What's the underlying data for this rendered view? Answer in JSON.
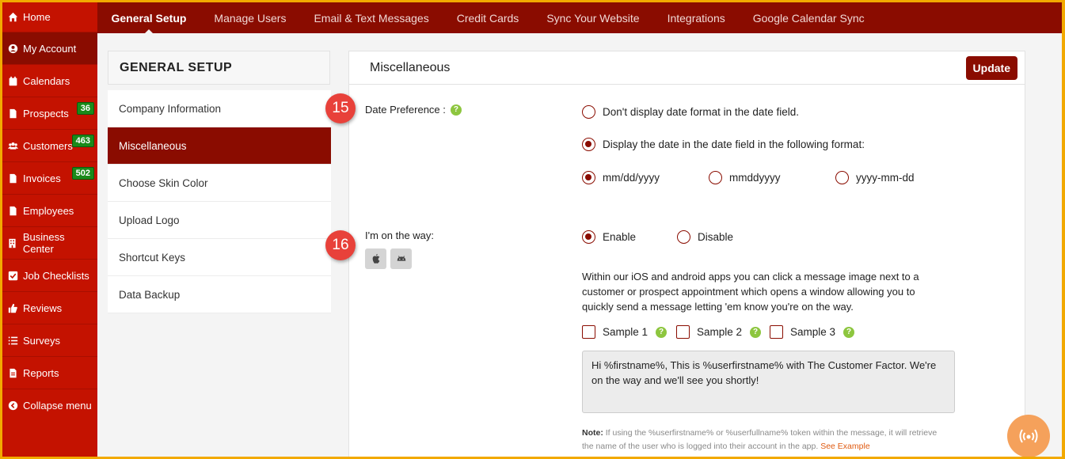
{
  "sidebar": {
    "items": [
      {
        "label": "Home",
        "icon": "home-icon"
      },
      {
        "label": "My Account",
        "icon": "user-circle-icon"
      },
      {
        "label": "Calendars",
        "icon": "calendar-icon"
      },
      {
        "label": "Prospects",
        "icon": "document-icon",
        "badge": "36"
      },
      {
        "label": "Customers",
        "icon": "users-icon",
        "badge": "463"
      },
      {
        "label": "Invoices",
        "icon": "document-icon",
        "badge": "502"
      },
      {
        "label": "Employees",
        "icon": "document-icon"
      },
      {
        "label": "Business Center",
        "icon": "building-icon"
      },
      {
        "label": "Job Checklists",
        "icon": "checkbox-icon"
      },
      {
        "label": "Reviews",
        "icon": "thumbs-up-icon"
      },
      {
        "label": "Surveys",
        "icon": "list-icon"
      },
      {
        "label": "Reports",
        "icon": "report-icon"
      },
      {
        "label": "Collapse menu",
        "icon": "chevron-left-circle-icon"
      }
    ]
  },
  "topnav": {
    "tabs": [
      "General Setup",
      "Manage Users",
      "Email & Text Messages",
      "Credit Cards",
      "Sync Your Website",
      "Integrations",
      "Google Calendar Sync"
    ]
  },
  "setup": {
    "heading": "GENERAL SETUP",
    "items": [
      "Company Information",
      "Miscellaneous",
      "Choose Skin Color",
      "Upload Logo",
      "Shortcut Keys",
      "Data Backup"
    ]
  },
  "main": {
    "title": "Miscellaneous",
    "update_label": "Update",
    "date_pref": {
      "step": "15",
      "label": "Date Preference :",
      "opt_none": "Don't display date format in the date field.",
      "opt_format": "Display the date in the date field in the following format:",
      "formats": [
        "mm/dd/yyyy",
        "mmddyyyy",
        "yyyy-mm-dd"
      ]
    },
    "on_way": {
      "step": "16",
      "label": "I'm on the way:",
      "enable": "Enable",
      "disable": "Disable",
      "description": "Within our iOS and android apps you can click a message image next to a customer or prospect appointment which opens a window allowing you to quickly send a message letting 'em know you're on the way.",
      "samples": [
        "Sample 1",
        "Sample 2",
        "Sample 3"
      ],
      "message": "Hi %firstname%, This is %userfirstname% with The Customer Factor. We're on the way and we'll see you shortly!",
      "note_label": "Note:",
      "note_text": " If using the %userfirstname% or %userfullname% token within the message, it will retrieve the name of the user who is logged into their account in the app. ",
      "note_link": "See Example"
    }
  },
  "colors": {
    "sidebar": "#c41200",
    "accent": "#8a0c00",
    "badge": "#1a8a1a",
    "step_marker": "#e8413a",
    "help": "#8dc63f"
  }
}
